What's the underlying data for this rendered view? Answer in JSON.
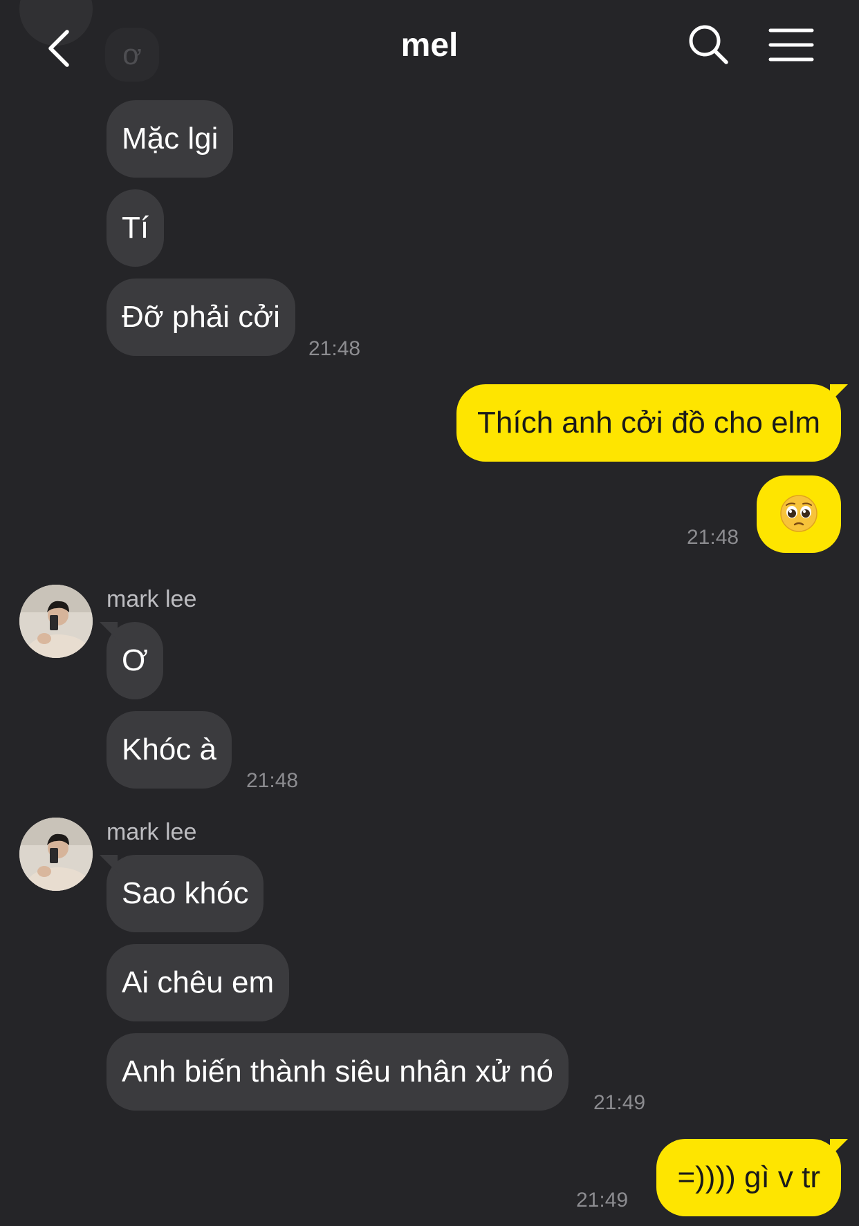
{
  "header": {
    "title": "mel",
    "back_icon": "chevron-left-icon",
    "search_icon": "search-icon",
    "menu_icon": "hamburger-menu-icon"
  },
  "partial_message": {
    "text": "ơ"
  },
  "messages": [
    {
      "side": "in",
      "text": "Mặc lgi"
    },
    {
      "side": "in",
      "text": "Tí"
    },
    {
      "side": "in",
      "text": "Đỡ phải cởi",
      "time": "21:48"
    },
    {
      "side": "out",
      "text": "Thích anh cởi đồ cho elm"
    },
    {
      "side": "out",
      "emoji": "pleading-face-emoji",
      "time": "21:48"
    },
    {
      "side": "in",
      "sender": "mark lee",
      "text": "Ơ"
    },
    {
      "side": "in",
      "text": "Khóc à",
      "time": "21:48"
    },
    {
      "side": "in",
      "sender": "mark lee",
      "text": "Sao khóc"
    },
    {
      "side": "in",
      "text": "Ai chêu em"
    },
    {
      "side": "in",
      "text": "Anh biến thành siêu nhân xử nó",
      "time": "21:49"
    },
    {
      "side": "out",
      "text": "=)))) gì v tr",
      "time": "21:49"
    }
  ],
  "colors": {
    "background": "#252528",
    "incoming_bubble": "#3b3b3e",
    "outgoing_bubble": "#fee500",
    "timestamp": "#8c8c90"
  }
}
